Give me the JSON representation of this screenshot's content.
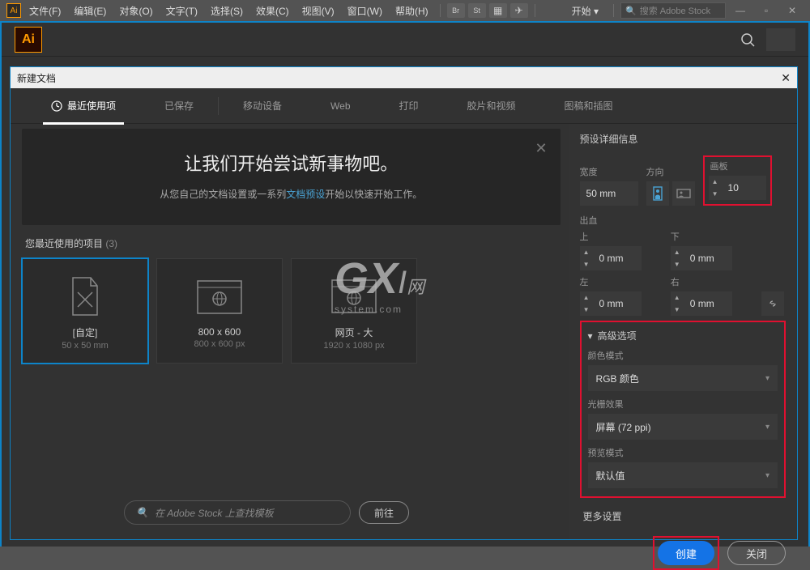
{
  "menubar": {
    "items": [
      "文件(F)",
      "编辑(E)",
      "对象(O)",
      "文字(T)",
      "选择(S)",
      "效果(C)",
      "视图(V)",
      "窗口(W)",
      "帮助(H)"
    ],
    "start": "开始 ▾",
    "search_placeholder": "搜索 Adobe Stock",
    "logo": "Ai"
  },
  "toolbar": {
    "logo": "Ai"
  },
  "dialog": {
    "title": "新建文档",
    "tabs": [
      "最近使用项",
      "已保存",
      "移动设备",
      "Web",
      "打印",
      "胶片和视频",
      "图稿和插图"
    ],
    "hero_title": "让我们开始尝试新事物吧。",
    "hero_text_before": "从您自己的文档设置或一系列",
    "hero_link": "文档预设",
    "hero_text_after": "开始以快速开始工作。",
    "recent_label": "您最近使用的项目",
    "recent_count": "(3)",
    "cards": [
      {
        "title": "[自定]",
        "sub": "50 x 50 mm"
      },
      {
        "title": "800 x 600",
        "sub": "800 x 600 px"
      },
      {
        "title": "网页 - 大",
        "sub": "1920 x 1080 px"
      }
    ],
    "search_placeholder": "在 Adobe Stock 上查找模板",
    "go_label": "前往"
  },
  "details": {
    "header": "预设详细信息",
    "width_label": "宽度",
    "width_value": "50 mm",
    "orientation_label": "方向",
    "artboard_label": "画板",
    "artboard_value": "10",
    "bleed_label": "出血",
    "top_label": "上",
    "top_value": "0 mm",
    "bottom_label": "下",
    "bottom_value": "0 mm",
    "left_label": "左",
    "left_value": "0 mm",
    "right_label": "右",
    "right_value": "0 mm",
    "advanced_label": "高级选项",
    "color_mode_label": "颜色模式",
    "color_mode_value": "RGB 颜色",
    "raster_label": "光栅效果",
    "raster_value": "屏幕 (72 ppi)",
    "preview_label": "预览模式",
    "preview_value": "默认值",
    "more_settings": "更多设置",
    "create_btn": "创建",
    "close_btn": "关闭"
  },
  "watermark": {
    "brand": "GX",
    "suffix": "I",
    "net": "网",
    "domain": "system.com"
  }
}
